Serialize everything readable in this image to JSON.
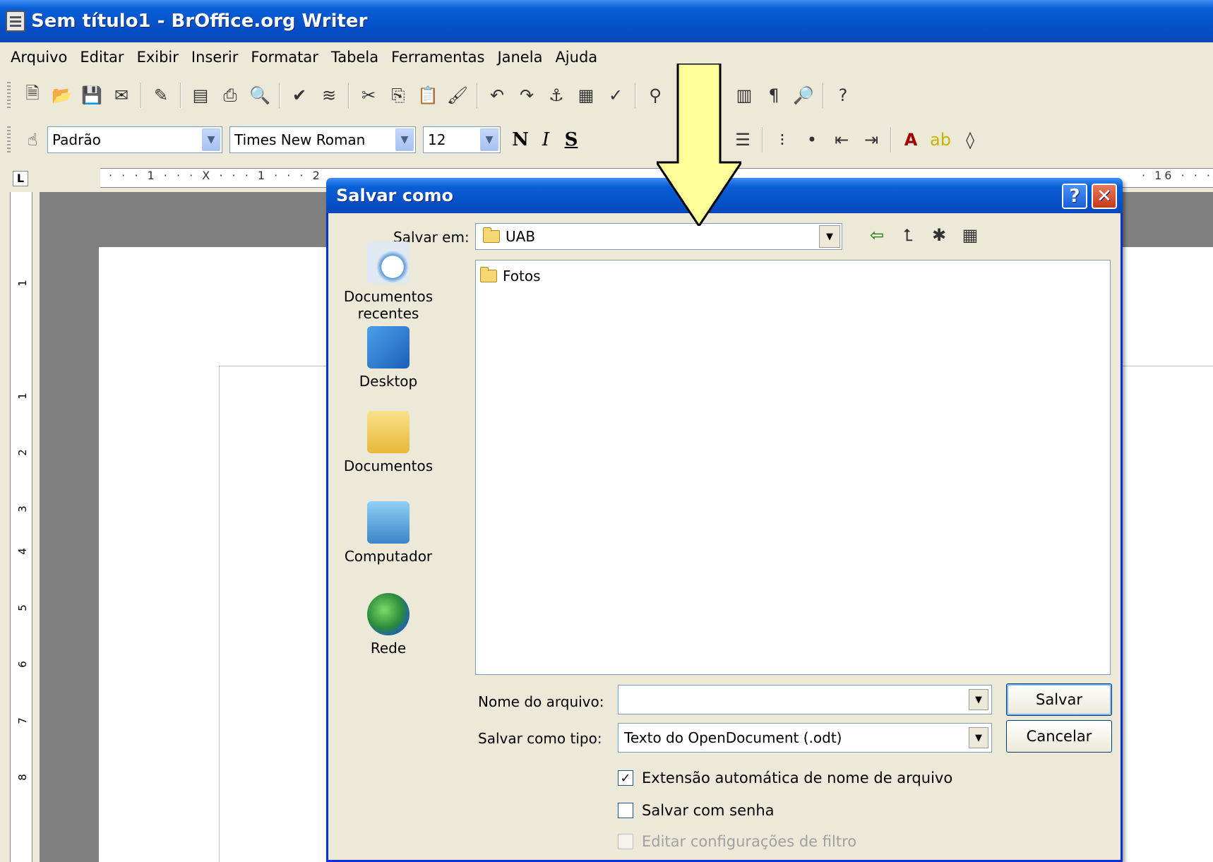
{
  "window": {
    "title": "Sem título1 - BrOffice.org Writer"
  },
  "menu": [
    "Arquivo",
    "Editar",
    "Exibir",
    "Inserir",
    "Formatar",
    "Tabela",
    "Ferramentas",
    "Janela",
    "Ajuda"
  ],
  "formatting": {
    "style": "Padrão",
    "font": "Times New Roman",
    "size": "12"
  },
  "ruler": {
    "horizontal_text": "· · · 1 · · · X · · · 1 · · · 2",
    "right_text": "· 16 · · ·"
  },
  "dialog": {
    "title": "Salvar como",
    "help_label": "?",
    "close_label": "✕",
    "save_in_label": "Salvar em:",
    "save_in_value": "UAB",
    "places": [
      "Documentos recentes",
      "Desktop",
      "Documentos",
      "Computador",
      "Rede"
    ],
    "files": [
      "Fotos"
    ],
    "filename_label": "Nome do arquivo:",
    "filename_value": "",
    "filetype_label": "Salvar como tipo:",
    "filetype_value": "Texto do OpenDocument (.odt)",
    "save_button": "Salvar",
    "cancel_button": "Cancelar",
    "options": [
      {
        "label": "Extensão automática de nome de arquivo",
        "checked": true,
        "enabled": true
      },
      {
        "label": "Salvar com senha",
        "checked": false,
        "enabled": true
      },
      {
        "label": "Editar configurações de filtro",
        "checked": false,
        "enabled": false
      }
    ]
  },
  "annotation": {
    "arrow_color": "#ffff99"
  }
}
